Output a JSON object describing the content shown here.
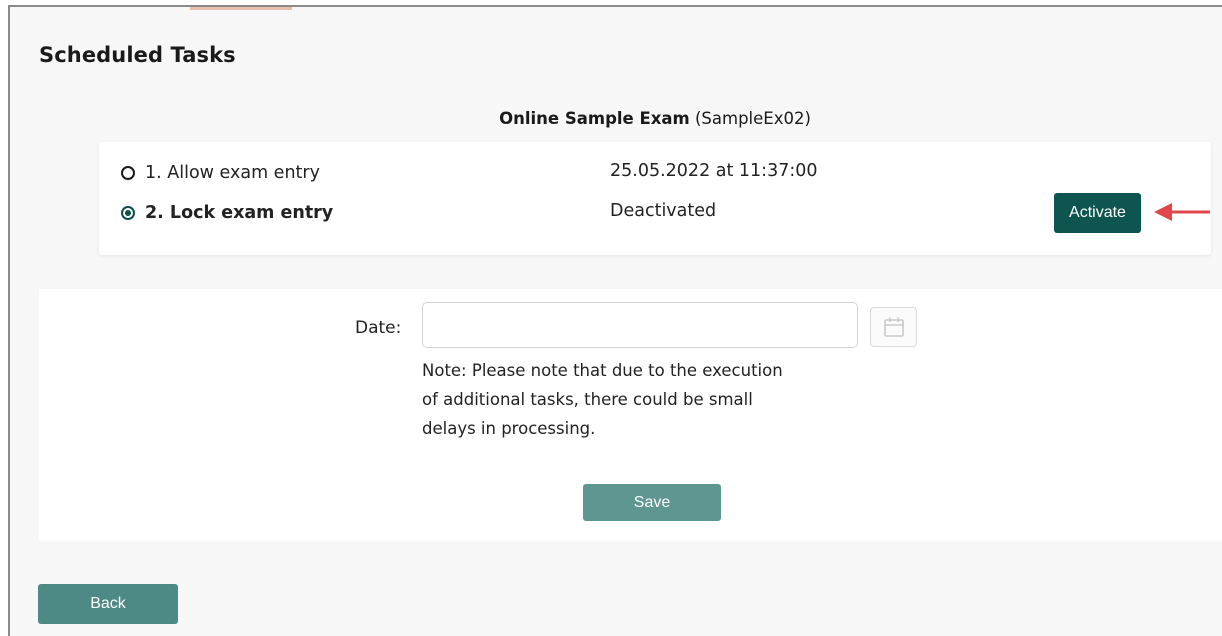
{
  "page": {
    "title": "Scheduled Tasks"
  },
  "exam": {
    "name": "Online Sample Exam",
    "code": "(SampleEx02)"
  },
  "tasks": [
    {
      "label": "1. Allow exam entry",
      "status": "25.05.2022 at 11:37:00",
      "selected": false
    },
    {
      "label": "2. Lock exam entry",
      "status": "Deactivated",
      "selected": true,
      "action_label": "Activate"
    }
  ],
  "form": {
    "date_label": "Date:",
    "date_value": "",
    "note_lines": [
      "Note: Please note that due to the execution",
      "of additional tasks, there could be small",
      "delays in processing."
    ],
    "save_label": "Save"
  },
  "footer": {
    "back_label": "Back"
  },
  "icons": {
    "calendar": "calendar-icon",
    "arrow": "red-arrow-left-icon"
  },
  "colors": {
    "primary_dark": "#0e5550",
    "primary_muted": "#5e9792",
    "back_button": "#4e8a85",
    "arrow": "#e0474c",
    "page_background": "#f7f7f7"
  }
}
